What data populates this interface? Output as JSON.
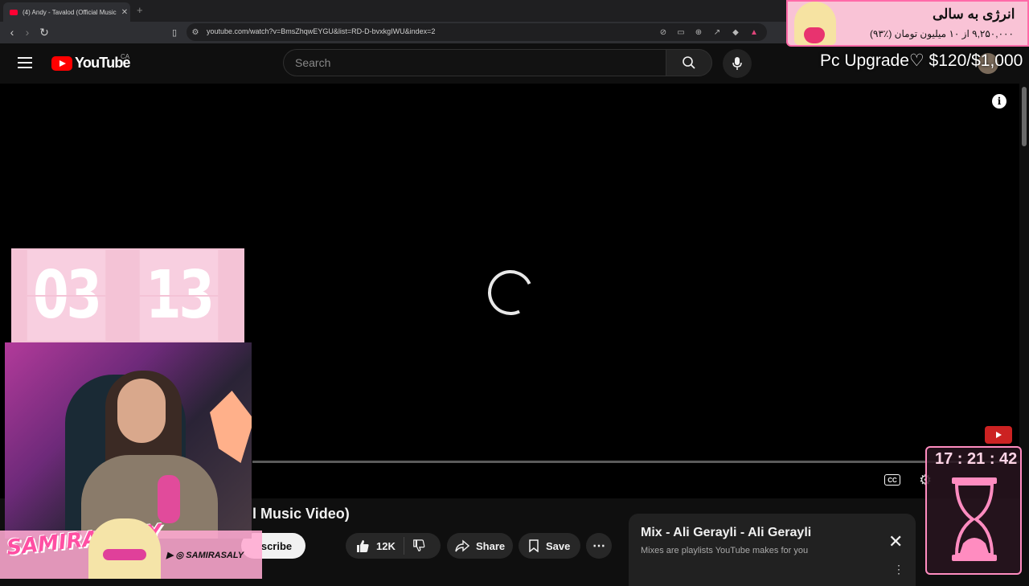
{
  "browser": {
    "tab_title": "(4) Andy - Tavalod (Official Music",
    "url": "youtube.com/watch?v=BmsZhqwEYGU&list=RD-D-bvxkgIWU&index=2"
  },
  "youtube": {
    "logo_text": "YouTube",
    "region": "CA",
    "search_placeholder": "Search"
  },
  "video": {
    "title_fragment": "l Music Video)",
    "subscribe_label": "Subscribe",
    "subscribe_visible": "scribe",
    "likes": "12K",
    "share_label": "Share",
    "save_label": "Save",
    "cc_label": "CC"
  },
  "mix_panel": {
    "title": "Mix - Ali Gerayli - Ali Gerayli",
    "subtitle": "Mixes are playlists YouTube makes for you"
  },
  "stream_overlay": {
    "countdown_minutes": "03",
    "countdown_seconds": "13",
    "clock": "17 : 21 : 42",
    "goal_text": "Pc Upgrade♡ $120/$1,000",
    "streamer_name": "SAMIRA SALY",
    "social_handle": "SAMIRASALY",
    "donation_title": "انرژی به سالی",
    "donation_sub": "۹,۲۵۰,۰۰۰ از ۱۰ میلیون تومان (٪۹۳)",
    "accent_color": "#ff6aa8"
  }
}
